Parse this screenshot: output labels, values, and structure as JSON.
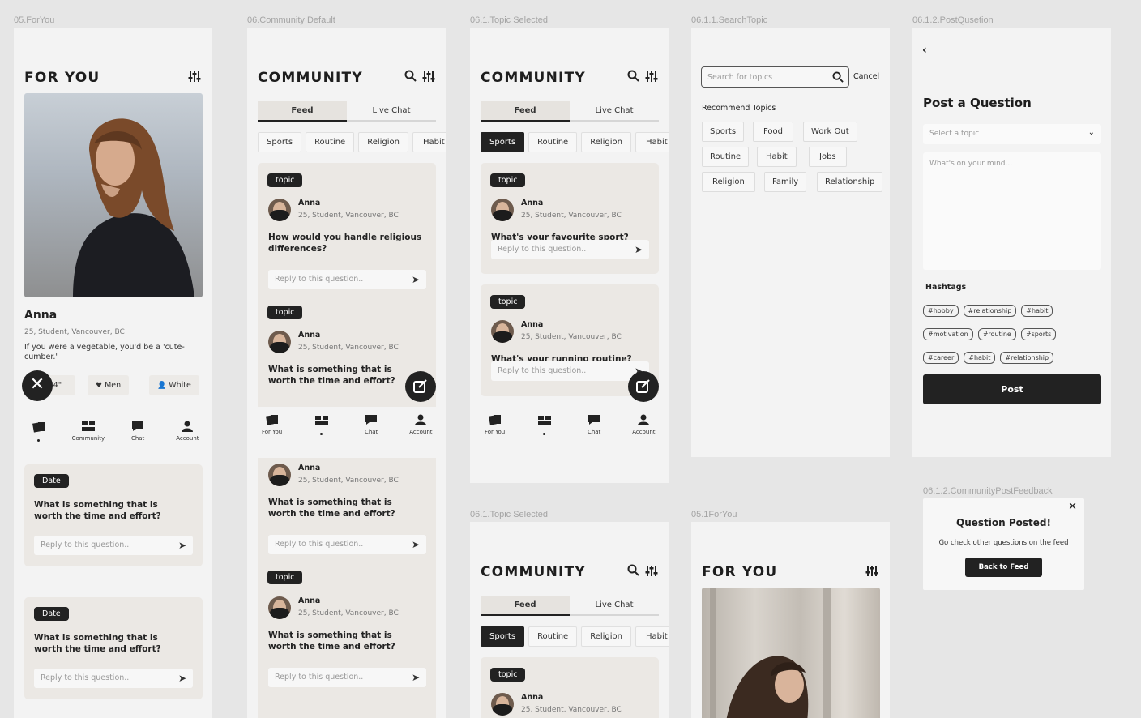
{
  "frames": {
    "f1_label": "05.ForYou",
    "f2_label": "06.Community Default",
    "f3_label": "06.1.Topic Selected",
    "f4_label": "06.1.1.SearchTopic",
    "f5_label": "06.1.2.PostQusetion",
    "f6_label": "06.1.Topic Selected",
    "f7_label": "05.1ForYou",
    "f8_label": "06.1.2.CommunityPostFeedback"
  },
  "for_you": {
    "title": "FOR YOU",
    "name": "Anna",
    "meta": "25, Student, Vancouver, BC",
    "bio": "If you were a vegetable, you'd be a 'cute-cumber.'",
    "filters": [
      "5'4\"",
      "Men",
      "White"
    ],
    "cards": [
      {
        "pill": "Date",
        "question": "What is something that is worth the time and effort?",
        "reply": "Reply to this question.."
      },
      {
        "pill": "Date",
        "question": "What is something that is worth the time and effort?",
        "reply": "Reply to this question.."
      }
    ]
  },
  "nav": {
    "for_you": "For You",
    "community": "Community",
    "chat": "Chat",
    "account": "Account"
  },
  "community": {
    "title": "COMMUNITY",
    "tab_feed": "Feed",
    "tab_live": "Live Chat",
    "chips": [
      "Sports",
      "Routine",
      "Religion",
      "Habit"
    ],
    "user": "Anna",
    "user_meta": "25, Student, Vancouver, BC",
    "topic": "topic",
    "reply": "Reply to this question..",
    "q_religion": "How would you handle religious differences?",
    "q_worth": "What is something that is worth the time and effort?",
    "q_sport": "What's your favourite sport?",
    "q_running": "What's your running routine?"
  },
  "search": {
    "placeholder": "Search for topics",
    "cancel": "Cancel",
    "recommend": "Recommend Topics",
    "topics": [
      "Sports",
      "Food",
      "Work Out",
      "Routine",
      "Habit",
      "Jobs",
      "Religion",
      "Family",
      "Relationship"
    ]
  },
  "post": {
    "title": "Post a Question",
    "select": "Select a topic",
    "placeholder": "What's on your mind...",
    "hashtags_label": "Hashtags",
    "hashtags": [
      "#hobby",
      "#relationship",
      "#habit",
      "#motivation",
      "#routine",
      "#sports",
      "#career",
      "#habit",
      "#relationship"
    ],
    "button": "Post"
  },
  "feedback": {
    "title": "Question Posted!",
    "text": "Go check other questions on the feed",
    "button": "Back to Feed"
  }
}
